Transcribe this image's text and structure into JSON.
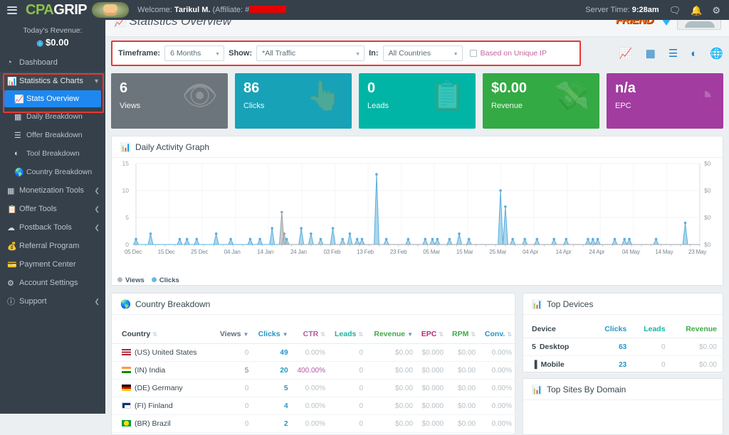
{
  "topbar": {
    "logo_cpa": "CPA",
    "logo_grip": "GRIP",
    "welcome_prefix": "Welcome:",
    "welcome_user": "Tarikul M.",
    "welcome_affiliate": "(Affiliate: #",
    "server_time_label": "Server Time:",
    "server_time_value": "9:28am",
    "icons": [
      "menu-icon",
      "chat-icon",
      "bell-icon",
      "gear-icon"
    ]
  },
  "sidebar": {
    "revenue_label": "Today's Revenue:",
    "revenue_value": "$0.00",
    "items": [
      {
        "label": "Dashboard",
        "icon": "dashboard-icon"
      },
      {
        "label": "Statistics & Charts",
        "icon": "bar-chart-icon"
      },
      {
        "label": "Stats Overview",
        "icon": "line-chart-icon"
      },
      {
        "label": "Daily Breakdown",
        "icon": "table-icon"
      },
      {
        "label": "Offer Breakdown",
        "icon": "list-icon"
      },
      {
        "label": "Tool Breakdown",
        "icon": "pie-chart-icon"
      },
      {
        "label": "Country Breakdown",
        "icon": "globe-icon"
      },
      {
        "label": "Monetization Tools",
        "icon": "grid-icon"
      },
      {
        "label": "Offer Tools",
        "icon": "clipboard-icon"
      },
      {
        "label": "Postback Tools",
        "icon": "cloud-icon"
      },
      {
        "label": "Referral Program",
        "icon": "coin-icon"
      },
      {
        "label": "Payment Center",
        "icon": "money-icon"
      },
      {
        "label": "Account Settings",
        "icon": "gear-icon"
      },
      {
        "label": "Support",
        "icon": "info-icon"
      }
    ]
  },
  "page": {
    "title": "Statistics Overview",
    "title_icon": "line-chart-icon",
    "banner_text": "FRIEND"
  },
  "filters": {
    "timeframe_label": "Timeframe:",
    "timeframe_value": "6 Months",
    "show_label": "Show:",
    "show_value": "*All Traffic",
    "in_label": "In:",
    "in_value": "All Countries",
    "unique_ip_label": "Based on Unique IP",
    "unique_ip_checked": false,
    "view_icons": [
      "line-chart-view-icon",
      "table-view-icon",
      "list-view-icon",
      "pie-chart-view-icon",
      "globe-view-icon"
    ]
  },
  "cards": [
    {
      "value": "6",
      "label": "Views",
      "color": "#6d757c",
      "icon": "eye-icon",
      "glyph": "◉"
    },
    {
      "value": "86",
      "label": "Clicks",
      "color": "#17a2b8",
      "icon": "hand-pointer-icon",
      "glyph": "☝"
    },
    {
      "value": "0",
      "label": "Leads",
      "color": "#00b5a5",
      "icon": "clipboard-list-icon",
      "glyph": "Ὄb"
    },
    {
      "value": "$0.00",
      "label": "Revenue",
      "color": "#33aa44",
      "icon": "hand-money-icon",
      "glyph": "$"
    },
    {
      "value": "n/a",
      "label": "EPC",
      "color": "#a23ca0",
      "icon": "pie-chart-icon",
      "glyph": "◔"
    }
  ],
  "graph_panel": {
    "title": "Daily Activity Graph",
    "icon": "bar-chart-icon"
  },
  "chart_data": {
    "type": "area",
    "title": "Daily Activity Graph",
    "xlabel": "",
    "ylabel": "",
    "ylim": [
      0,
      15
    ],
    "yticks": [
      "0",
      "5",
      "10",
      "15"
    ],
    "y2ticks": [
      "$0",
      "$0",
      "$0",
      "$0"
    ],
    "grid": true,
    "legend_position": "bottom-left",
    "xtick_labels": [
      "05 Dec",
      "15 Dec",
      "25 Dec",
      "04 Jan",
      "14 Jan",
      "24 Jan",
      "03 Feb",
      "13 Feb",
      "23 Feb",
      "05 Mar",
      "15 Mar",
      "25 Mar",
      "04 Apr",
      "14 Apr",
      "24 Apr",
      "04 May",
      "14 May",
      "23 May"
    ],
    "series": [
      {
        "name": "Views",
        "color": "#b0b7bd",
        "points": [
          {
            "x": 60,
            "y": 6
          },
          {
            "x": 61,
            "y": 2
          }
        ]
      },
      {
        "name": "Clicks",
        "color": "#8ecae6",
        "points": [
          {
            "x": 0,
            "y": 1
          },
          {
            "x": 6,
            "y": 2
          },
          {
            "x": 18,
            "y": 1
          },
          {
            "x": 21,
            "y": 1
          },
          {
            "x": 25,
            "y": 1
          },
          {
            "x": 33,
            "y": 2
          },
          {
            "x": 39,
            "y": 1
          },
          {
            "x": 47,
            "y": 1
          },
          {
            "x": 51,
            "y": 1
          },
          {
            "x": 56,
            "y": 3
          },
          {
            "x": 62,
            "y": 1
          },
          {
            "x": 68,
            "y": 3
          },
          {
            "x": 72,
            "y": 2
          },
          {
            "x": 76,
            "y": 1
          },
          {
            "x": 81,
            "y": 3
          },
          {
            "x": 85,
            "y": 1
          },
          {
            "x": 88,
            "y": 2
          },
          {
            "x": 91,
            "y": 1
          },
          {
            "x": 93,
            "y": 1
          },
          {
            "x": 99,
            "y": 13
          },
          {
            "x": 103,
            "y": 1
          },
          {
            "x": 112,
            "y": 1
          },
          {
            "x": 119,
            "y": 1
          },
          {
            "x": 122,
            "y": 1
          },
          {
            "x": 124,
            "y": 1
          },
          {
            "x": 129,
            "y": 1
          },
          {
            "x": 133,
            "y": 2
          },
          {
            "x": 137,
            "y": 1
          },
          {
            "x": 150,
            "y": 10
          },
          {
            "x": 152,
            "y": 7
          },
          {
            "x": 155,
            "y": 1
          },
          {
            "x": 160,
            "y": 1
          },
          {
            "x": 165,
            "y": 1
          },
          {
            "x": 172,
            "y": 1
          },
          {
            "x": 177,
            "y": 1
          },
          {
            "x": 186,
            "y": 1
          },
          {
            "x": 188,
            "y": 1
          },
          {
            "x": 190,
            "y": 1
          },
          {
            "x": 197,
            "y": 1
          },
          {
            "x": 201,
            "y": 1
          },
          {
            "x": 203,
            "y": 1
          },
          {
            "x": 214,
            "y": 1
          },
          {
            "x": 226,
            "y": 4
          }
        ]
      }
    ]
  },
  "country_panel": {
    "title": "Country Breakdown",
    "icon": "globe-icon",
    "columns": [
      {
        "label": "Country",
        "color": "#37474f",
        "sort": "none"
      },
      {
        "label": "Views",
        "color": "#5c6f7d",
        "sort": "desc"
      },
      {
        "label": "Clicks",
        "color": "#2196c7",
        "sort": "desc"
      },
      {
        "label": "CTR",
        "color": "#b05aa0",
        "sort": "none"
      },
      {
        "label": "Leads",
        "color": "#15b5a0",
        "sort": "none"
      },
      {
        "label": "Revenue",
        "color": "#3faa4a",
        "sort": "desc"
      },
      {
        "label": "EPC",
        "color": "#c0267a",
        "sort": "none"
      },
      {
        "label": "RPM",
        "color": "#3faa4a",
        "sort": "none"
      },
      {
        "label": "Conv.",
        "color": "#2196c7",
        "sort": "none"
      }
    ],
    "rows": [
      {
        "country": "(US) United States",
        "flag": "us",
        "views": "0",
        "clicks": "49",
        "ctr": "0.00%",
        "leads": "0",
        "revenue": "$0.00",
        "epc": "$0.000",
        "rpm": "$0.00",
        "conv": "0.00%"
      },
      {
        "country": "(IN) India",
        "flag": "in",
        "views": "5",
        "clicks": "20",
        "ctr": "400.00%",
        "leads": "0",
        "revenue": "$0.00",
        "epc": "$0.000",
        "rpm": "$0.00",
        "conv": "0.00%"
      },
      {
        "country": "(DE) Germany",
        "flag": "de",
        "views": "0",
        "clicks": "5",
        "ctr": "0.00%",
        "leads": "0",
        "revenue": "$0.00",
        "epc": "$0.000",
        "rpm": "$0.00",
        "conv": "0.00%"
      },
      {
        "country": "(FI) Finland",
        "flag": "fi",
        "views": "0",
        "clicks": "4",
        "ctr": "0.00%",
        "leads": "0",
        "revenue": "$0.00",
        "epc": "$0.000",
        "rpm": "$0.00",
        "conv": "0.00%"
      },
      {
        "country": "(BR) Brazil",
        "flag": "br",
        "views": "0",
        "clicks": "2",
        "ctr": "0.00%",
        "leads": "0",
        "revenue": "$0.00",
        "epc": "$0.000",
        "rpm": "$0.00",
        "conv": "0.00%"
      }
    ]
  },
  "devices_panel": {
    "title": "Top Devices",
    "icon": "bar-chart-icon",
    "columns": [
      {
        "label": "Device",
        "color": "#37474f"
      },
      {
        "label": "Clicks",
        "color": "#2196c7"
      },
      {
        "label": "Leads",
        "color": "#15b5a0"
      },
      {
        "label": "Revenue",
        "color": "#3faa4a"
      }
    ],
    "rows": [
      {
        "device": "Desktop",
        "icon": "desktop-icon",
        "clicks": "63",
        "leads": "0",
        "revenue": "$0.00"
      },
      {
        "device": "Mobile",
        "icon": "mobile-icon",
        "clicks": "23",
        "leads": "0",
        "revenue": "$0.00"
      }
    ]
  },
  "sites_panel": {
    "title": "Top Sites By Domain",
    "icon": "bar-chart-icon"
  }
}
